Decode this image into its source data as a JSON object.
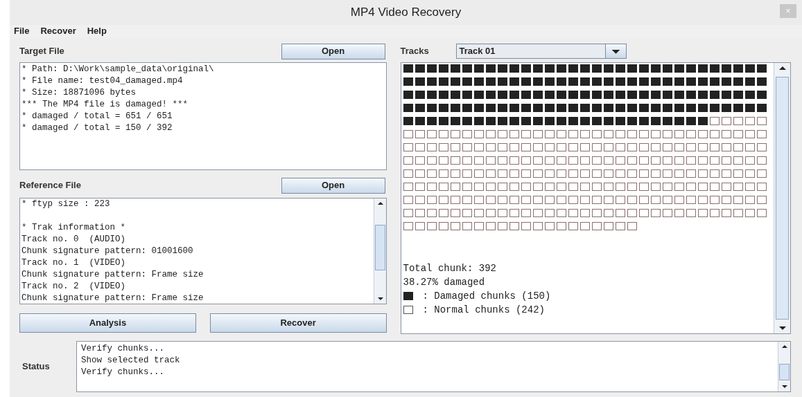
{
  "window": {
    "title": "MP4 Video Recovery",
    "close": "×"
  },
  "menu": [
    "File",
    "Recover",
    "Help"
  ],
  "target_file": {
    "label": "Target File",
    "button": "Open",
    "lines": [
      "* Path: D:\\Work\\sample_data\\original\\",
      "* File name: test04_damaged.mp4",
      "* Size: 18871096 bytes",
      "*** The MP4 file is damaged! ***",
      "* damaged / total = 651 / 651",
      "* damaged / total = 150 / 392"
    ]
  },
  "reference_file": {
    "label": "Reference File",
    "button": "Open",
    "paragraphs": [
      [
        "* ftyp size : 223"
      ],
      [
        "* Trak information *",
        "Track no. 0  (AUDIO)",
        "Chunk signature pattern: 01001600",
        "Track no. 1  (VIDEO)",
        "Chunk signature pattern: Frame size",
        "Track no. 2  (VIDEO)",
        "Chunk signature pattern: Frame size"
      ]
    ]
  },
  "actions": [
    "Analysis",
    "Recover"
  ],
  "tracks": {
    "label": "Tracks",
    "selected_value": "Track 01"
  },
  "chunk_map": {
    "rows": [
      [
        true,
        true,
        true,
        true,
        true,
        true,
        true,
        true,
        true,
        true,
        true,
        true,
        true,
        true,
        true,
        true,
        true,
        true,
        true,
        true,
        true,
        true,
        true,
        true,
        true,
        true,
        true,
        true,
        true,
        true,
        true
      ],
      [
        true,
        true,
        true,
        true,
        true,
        true,
        true,
        true,
        true,
        true,
        true,
        true,
        true,
        true,
        true,
        true,
        true,
        true,
        true,
        true,
        true,
        true,
        true,
        true,
        true,
        true,
        true,
        true,
        true,
        true,
        true
      ],
      [
        true,
        true,
        true,
        true,
        true,
        true,
        true,
        true,
        true,
        true,
        true,
        true,
        true,
        true,
        true,
        true,
        true,
        true,
        true,
        true,
        true,
        true,
        true,
        true,
        true,
        true,
        true,
        true,
        true,
        true,
        true
      ],
      [
        true,
        true,
        true,
        true,
        true,
        true,
        true,
        true,
        true,
        true,
        true,
        true,
        true,
        true,
        true,
        true,
        true,
        true,
        true,
        true,
        true,
        true,
        true,
        true,
        true,
        true,
        true,
        true,
        true,
        true,
        true
      ],
      [
        true,
        true,
        true,
        true,
        true,
        true,
        true,
        true,
        true,
        true,
        true,
        true,
        true,
        true,
        true,
        true,
        true,
        true,
        true,
        true,
        true,
        true,
        true,
        true,
        true,
        true,
        false,
        false,
        false,
        false,
        false
      ],
      [
        false,
        false,
        false,
        false,
        false,
        false,
        false,
        false,
        false,
        false,
        false,
        false,
        false,
        false,
        false,
        false,
        false,
        false,
        false,
        false,
        false,
        false,
        false,
        false,
        false,
        false,
        false,
        false,
        false,
        false,
        false
      ],
      [
        false,
        false,
        false,
        false,
        false,
        false,
        false,
        false,
        false,
        false,
        false,
        false,
        false,
        false,
        false,
        false,
        false,
        false,
        false,
        false,
        false,
        false,
        false,
        false,
        false,
        false,
        false,
        false,
        false,
        false,
        false
      ],
      [
        false,
        false,
        false,
        false,
        false,
        false,
        false,
        false,
        false,
        false,
        false,
        false,
        false,
        false,
        false,
        false,
        false,
        false,
        false,
        false,
        false,
        false,
        false,
        false,
        false,
        false,
        false,
        false,
        false,
        false,
        false
      ],
      [
        false,
        false,
        false,
        false,
        false,
        false,
        false,
        false,
        false,
        false,
        false,
        false,
        false,
        false,
        false,
        false,
        false,
        false,
        false,
        false,
        false,
        false,
        false,
        false,
        false,
        false,
        false,
        false,
        false,
        false,
        false
      ],
      [
        false,
        false,
        false,
        false,
        false,
        false,
        false,
        false,
        false,
        false,
        false,
        false,
        false,
        false,
        false,
        false,
        false,
        false,
        false,
        false,
        false,
        false,
        false,
        false,
        false,
        false,
        false,
        false,
        false,
        false,
        false
      ],
      [
        false,
        false,
        false,
        false,
        false,
        false,
        false,
        false,
        false,
        false,
        false,
        false,
        false,
        false,
        false,
        false,
        false,
        false,
        false,
        false,
        false,
        false,
        false,
        false,
        false,
        false,
        false,
        false,
        false,
        false,
        false
      ],
      [
        false,
        false,
        false,
        false,
        false,
        false,
        false,
        false,
        false,
        false,
        false,
        false,
        false,
        false,
        false,
        false,
        false,
        false,
        false,
        false,
        false,
        false,
        false,
        false,
        false,
        false,
        false,
        false,
        false,
        false,
        false
      ],
      [
        false,
        false,
        false,
        false,
        false,
        false,
        false,
        false,
        false,
        false,
        false,
        false,
        false,
        false,
        false,
        false,
        false,
        false,
        false,
        false
      ]
    ],
    "lines": [
      "Total chunk: 392",
      "38.27% damaged"
    ],
    "legend": [
      {
        "damaged": true,
        "text": ": Damaged chunks (150)"
      },
      {
        "damaged": false,
        "text": ": Normal chunks (242)"
      }
    ]
  },
  "status": {
    "label": "Status",
    "lines": [
      "Verify chunks...",
      "Show selected track",
      "Verify chunks..."
    ]
  }
}
